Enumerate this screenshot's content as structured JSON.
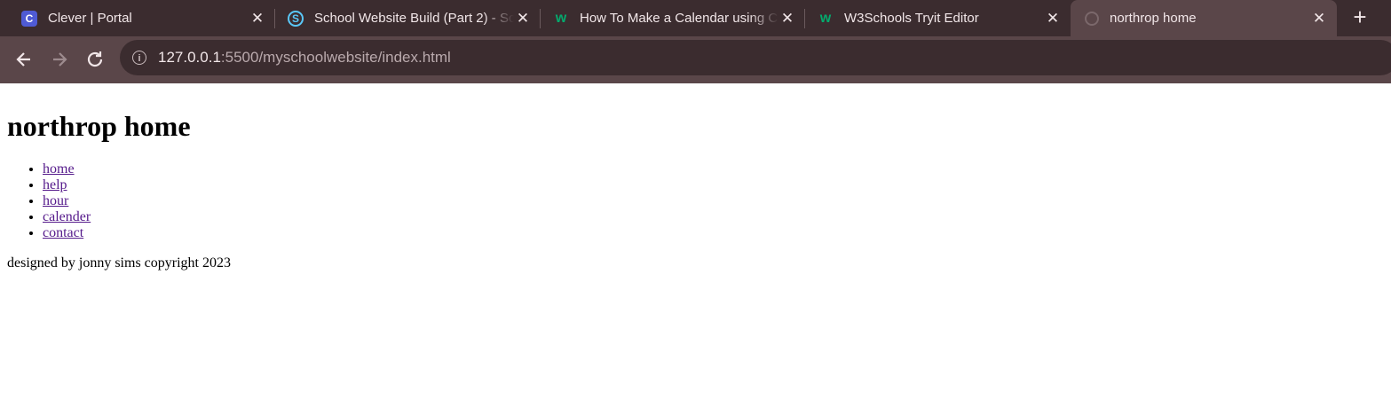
{
  "browser": {
    "tabs": [
      {
        "title": "Clever | Portal",
        "icon": "clever-icon",
        "icon_glyph": "C",
        "icon_color": "#4f5bd5",
        "active": false
      },
      {
        "title": "School Website Build (Part 2) - Sc",
        "icon": "schoology-icon",
        "icon_glyph": "S",
        "icon_color": "#5ac8fa",
        "active": false
      },
      {
        "title": "How To Make a Calendar using CSS",
        "icon": "w3schools-icon",
        "icon_glyph": "w",
        "icon_color": "#04aa6d",
        "active": false
      },
      {
        "title": "W3Schools Tryit Editor",
        "icon": "w3schools-icon",
        "icon_glyph": "w",
        "icon_color": "#04aa6d",
        "active": false
      },
      {
        "title": "northrop home",
        "icon": "globe-icon",
        "icon_glyph": "",
        "icon_color": "#6b5a5d",
        "active": true
      }
    ],
    "close_glyph": "✕",
    "new_tab_glyph": "+",
    "address": {
      "host": "127.0.0.1",
      "path": ":5500/myschoolwebsite/index.html"
    }
  },
  "page": {
    "heading": "northrop home",
    "nav_links": [
      "home",
      "help",
      "hour",
      "calender",
      "contact"
    ],
    "footer": "designed by jonny sims copyright 2023"
  },
  "colors": {
    "chrome_dark": "#3b2c2f",
    "chrome_active": "#5a4649",
    "link_visited": "#551a8b"
  }
}
